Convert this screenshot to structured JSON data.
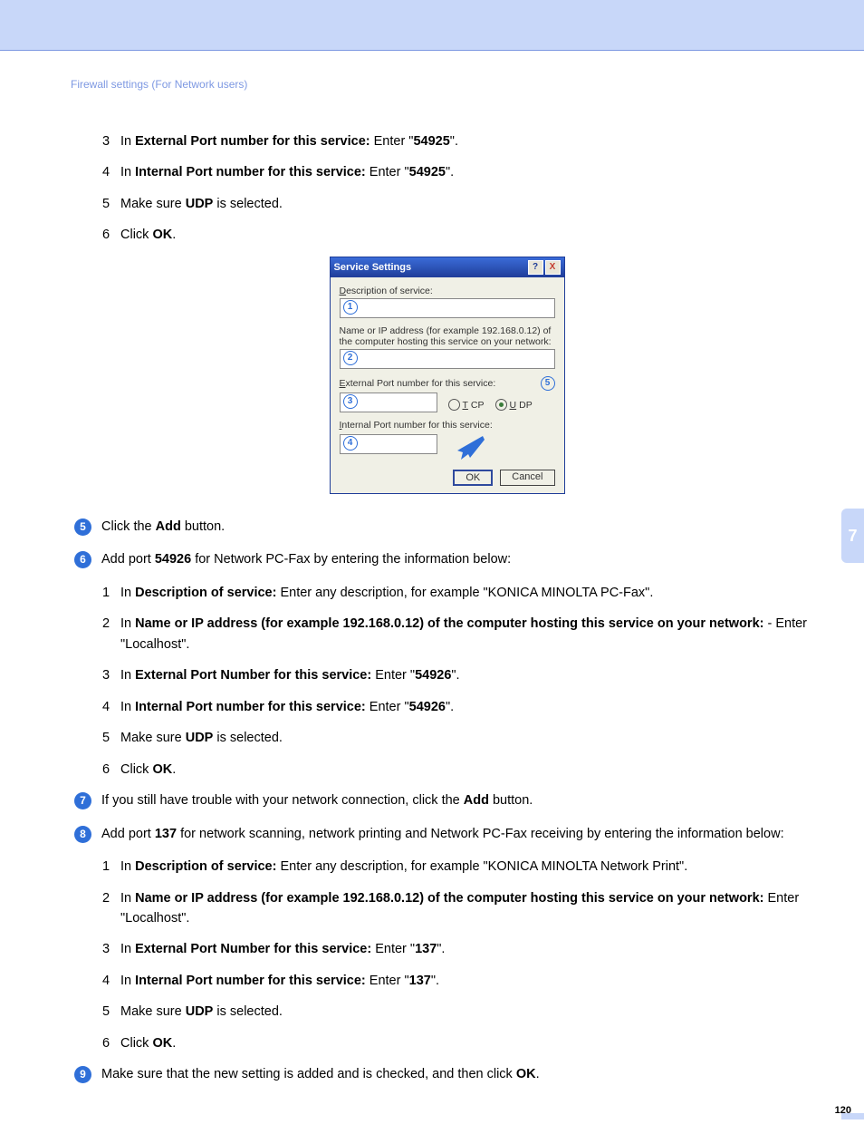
{
  "header": {
    "crumb": "Firewall settings (For Network users)"
  },
  "chapter_tab": "7",
  "page_number": "120",
  "block_a": {
    "items": [
      {
        "n": "3",
        "pre": "In ",
        "b": "External Port number for this service:",
        "mid": " Enter \"",
        "v": "54925",
        "post": "\"."
      },
      {
        "n": "4",
        "pre": "In ",
        "b": "Internal Port number for this service:",
        "mid": " Enter \"",
        "v": "54925",
        "post": "\"."
      },
      {
        "n": "5",
        "pre": "Make sure ",
        "b": "UDP",
        "mid": " is selected.",
        "v": "",
        "post": ""
      },
      {
        "n": "6",
        "pre": "Click ",
        "b": "OK",
        "mid": ".",
        "v": "",
        "post": ""
      }
    ]
  },
  "dialog": {
    "title": "Service Settings",
    "help": "?",
    "close": "X",
    "lbl_desc": "Description of service:",
    "lbl_ip": "Name or IP address (for example 192.168.0.12) of the computer hosting this service on your network:",
    "lbl_ext": "External Port number for this service:",
    "lbl_int": "Internal Port number for this service:",
    "tcp": "TCP",
    "udp": "UDP",
    "ok": "OK",
    "cancel": "Cancel",
    "b1": "1",
    "b2": "2",
    "b3": "3",
    "b4": "4",
    "b5": "5"
  },
  "step5": {
    "n": "5",
    "pre": "Click the ",
    "b": "Add",
    "post": " button."
  },
  "step6": {
    "n": "6",
    "pre": "Add port ",
    "b": "54926",
    "post": " for Network PC-Fax by entering the information below:"
  },
  "step6_items": [
    {
      "n": "1",
      "pre": "In ",
      "b": "Description of service:",
      "mid": " Enter any description, for example \"KONICA MINOLTA PC-Fax\"."
    },
    {
      "n": "2",
      "pre": "In ",
      "b": "Name or IP address (for example 192.168.0.12) of the computer hosting this service on your network:",
      "mid": " - Enter \"Localhost\"."
    },
    {
      "n": "3",
      "pre": "In ",
      "b": "External Port Number for this service:",
      "mid": " Enter \"",
      "v": "54926",
      "post": "\"."
    },
    {
      "n": "4",
      "pre": "In ",
      "b": "Internal Port number for this service:",
      "mid": " Enter \"",
      "v": "54926",
      "post": "\"."
    },
    {
      "n": "5",
      "pre": "Make sure ",
      "b": "UDP",
      "mid": " is selected."
    },
    {
      "n": "6",
      "pre": "Click ",
      "b": "OK",
      "mid": "."
    }
  ],
  "step7": {
    "n": "7",
    "pre": "If you still have trouble with your network connection, click the ",
    "b": "Add",
    "post": " button."
  },
  "step8": {
    "n": "8",
    "pre": "Add port ",
    "b": "137",
    "post": " for network scanning, network printing and Network PC-Fax receiving by entering the information below:"
  },
  "step8_items": [
    {
      "n": "1",
      "pre": "In ",
      "b": "Description of service:",
      "mid": " Enter any description, for example \"KONICA MINOLTA Network Print\"."
    },
    {
      "n": "2",
      "pre": "In ",
      "b": "Name or IP address (for example 192.168.0.12) of the computer hosting this service on your network:",
      "mid": " Enter \"Localhost\"."
    },
    {
      "n": "3",
      "pre": "In ",
      "b": "External Port Number for this service:",
      "mid": " Enter \"",
      "v": "137",
      "post": "\"."
    },
    {
      "n": "4",
      "pre": "In ",
      "b": "Internal Port number for this service:",
      "mid": " Enter \"",
      "v": "137",
      "post": "\"."
    },
    {
      "n": "5",
      "pre": "Make sure ",
      "b": "UDP",
      "mid": " is selected."
    },
    {
      "n": "6",
      "pre": "Click ",
      "b": "OK",
      "mid": "."
    }
  ],
  "step9": {
    "n": "9",
    "pre": "Make sure that the new setting is added and is checked, and then click ",
    "b": "OK",
    "post": "."
  }
}
